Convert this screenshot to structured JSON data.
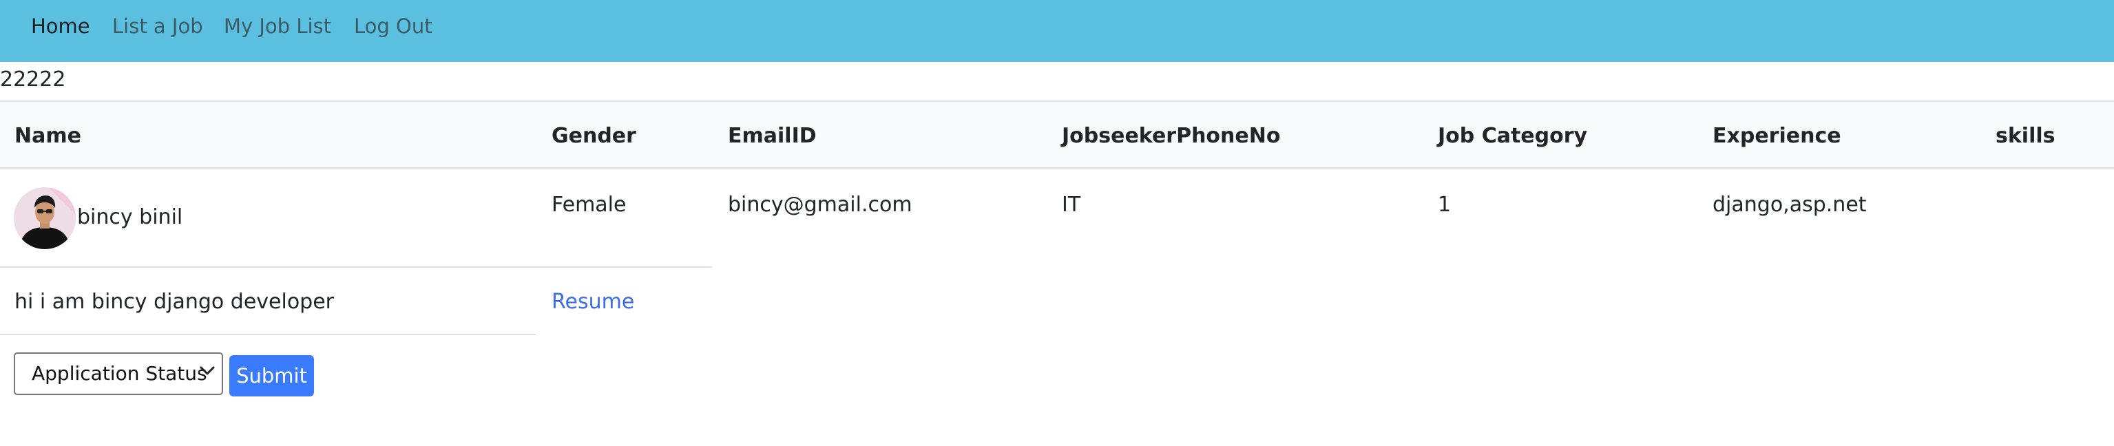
{
  "nav": {
    "items": [
      {
        "label": "Home",
        "active": true
      },
      {
        "label": "List a Job",
        "active": false
      },
      {
        "label": "My Job List",
        "active": false
      },
      {
        "label": "Log Out",
        "active": false
      }
    ]
  },
  "job_id": "22222",
  "table": {
    "headers": [
      "Name",
      "Gender",
      "EmailID",
      "JobseekerPhoneNo",
      "Job Category",
      "Experience",
      "skills"
    ],
    "row": {
      "name": "bincy binil",
      "gender": "Female",
      "email": "bincy@gmail.com",
      "phone": "IT",
      "job_category": "1",
      "experience": "django,asp.net",
      "skills": ""
    },
    "bio": "hi i am bincy django developer",
    "resume_label": "Resume"
  },
  "form": {
    "status_selected": "Application Status",
    "submit_label": "Submit"
  },
  "colors": {
    "navbar": "#5bc0e0",
    "link": "#3b6ee8",
    "primary_button": "#3a7bfd",
    "header_bg": "#f8f9fa"
  }
}
